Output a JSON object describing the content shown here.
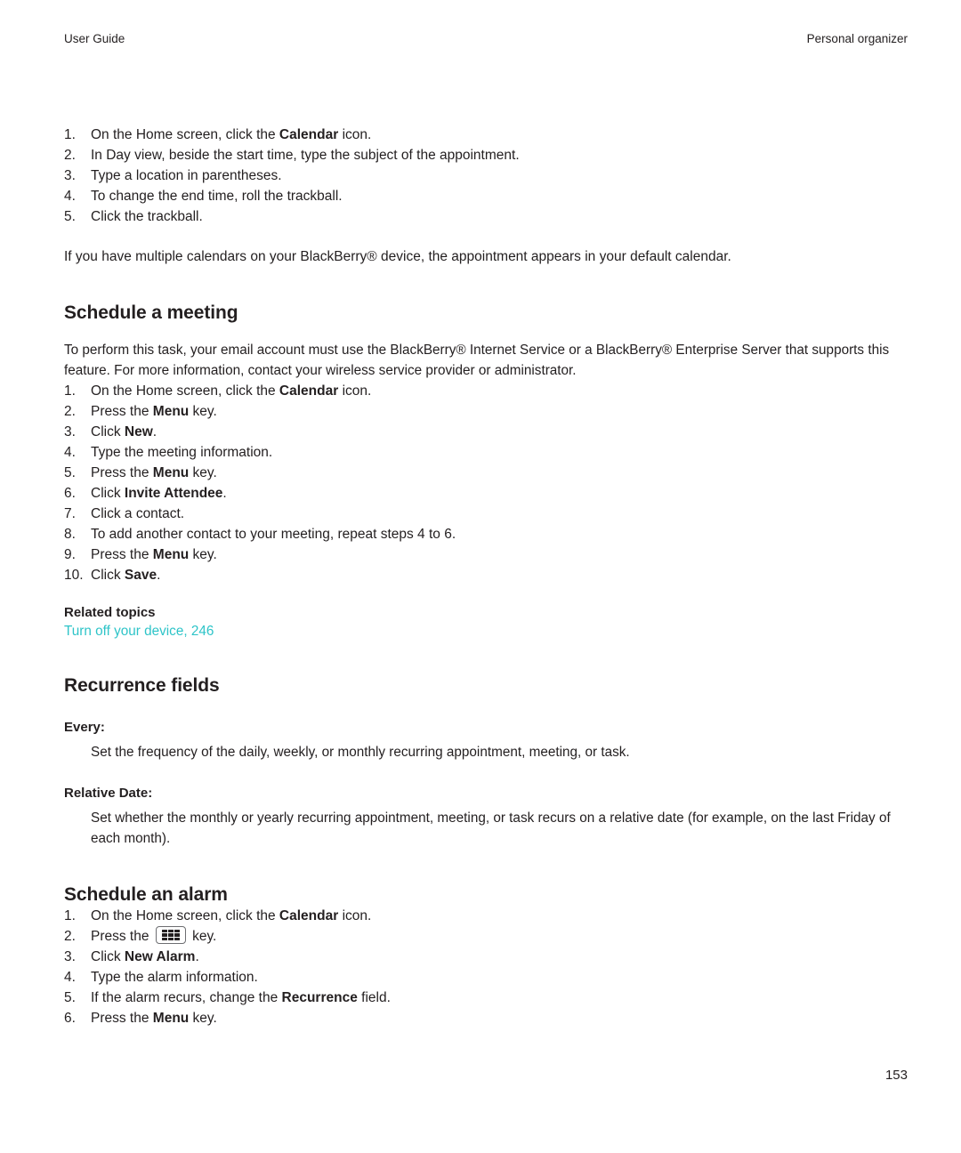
{
  "header": {
    "left": "User Guide",
    "right": "Personal organizer"
  },
  "top_steps": [
    {
      "num": "1.",
      "pre": "On the Home screen, click the ",
      "bold": "Calendar",
      "post": " icon."
    },
    {
      "num": "2.",
      "pre": "In Day view, beside the start time, type the subject of the appointment.",
      "bold": "",
      "post": ""
    },
    {
      "num": "3.",
      "pre": "Type a location in parentheses.",
      "bold": "",
      "post": ""
    },
    {
      "num": "4.",
      "pre": "To change the end time, roll the trackball.",
      "bold": "",
      "post": ""
    },
    {
      "num": "5.",
      "pre": "Click the trackball.",
      "bold": "",
      "post": ""
    }
  ],
  "top_note": "If you have multiple calendars on your BlackBerry® device, the appointment appears in your default calendar.",
  "meeting": {
    "heading": "Schedule a meeting",
    "intro": "To perform this task, your email account must use the BlackBerry® Internet Service or a BlackBerry® Enterprise Server that supports this feature. For more information, contact your wireless service provider or administrator.",
    "steps": [
      {
        "num": "1.",
        "pre": "On the Home screen, click the ",
        "bold": "Calendar",
        "post": " icon."
      },
      {
        "num": "2.",
        "pre": "Press the ",
        "bold": "Menu",
        "post": " key."
      },
      {
        "num": "3.",
        "pre": "Click ",
        "bold": "New",
        "post": "."
      },
      {
        "num": "4.",
        "pre": "Type the meeting information.",
        "bold": "",
        "post": ""
      },
      {
        "num": "5.",
        "pre": "Press the ",
        "bold": "Menu",
        "post": " key."
      },
      {
        "num": "6.",
        "pre": "Click ",
        "bold": "Invite Attendee",
        "post": "."
      },
      {
        "num": "7.",
        "pre": "Click a contact.",
        "bold": "",
        "post": ""
      },
      {
        "num": "8.",
        "pre": "To add another contact to your meeting, repeat steps 4 to 6.",
        "bold": "",
        "post": ""
      },
      {
        "num": "9.",
        "pre": "Press the ",
        "bold": "Menu",
        "post": " key."
      },
      {
        "num": "10.",
        "pre": "Click ",
        "bold": "Save",
        "post": "."
      }
    ],
    "related_title": "Related topics",
    "related_link": "Turn off your device, 246"
  },
  "recurrence": {
    "heading": "Recurrence fields",
    "fields": [
      {
        "term": "Every:",
        "definition": "Set the frequency of the daily, weekly, or monthly recurring appointment, meeting, or task."
      },
      {
        "term": "Relative Date:",
        "definition": "Set whether the monthly or yearly recurring appointment, meeting, or task recurs on a relative date (for example, on the last Friday of each month)."
      }
    ]
  },
  "alarm": {
    "heading": "Schedule an alarm",
    "steps": [
      {
        "num": "1.",
        "pre": "On the Home screen, click the ",
        "bold": "Calendar",
        "post": " icon.",
        "key_icon": false
      },
      {
        "num": "2.",
        "pre": "Press the ",
        "bold": "",
        "post": " key.",
        "key_icon": true
      },
      {
        "num": "3.",
        "pre": "Click ",
        "bold": "New Alarm",
        "post": ".",
        "key_icon": false
      },
      {
        "num": "4.",
        "pre": "Type the alarm information.",
        "bold": "",
        "post": "",
        "key_icon": false
      },
      {
        "num": "5.",
        "pre": "If the alarm recurs, change the ",
        "bold": "Recurrence",
        "post": " field.",
        "key_icon": false
      },
      {
        "num": "6.",
        "pre": "Press the ",
        "bold": "Menu",
        "post": " key.",
        "key_icon": false
      }
    ]
  },
  "page_number": "153",
  "colors": {
    "link": "#2ec4c8",
    "text": "#231f20"
  }
}
